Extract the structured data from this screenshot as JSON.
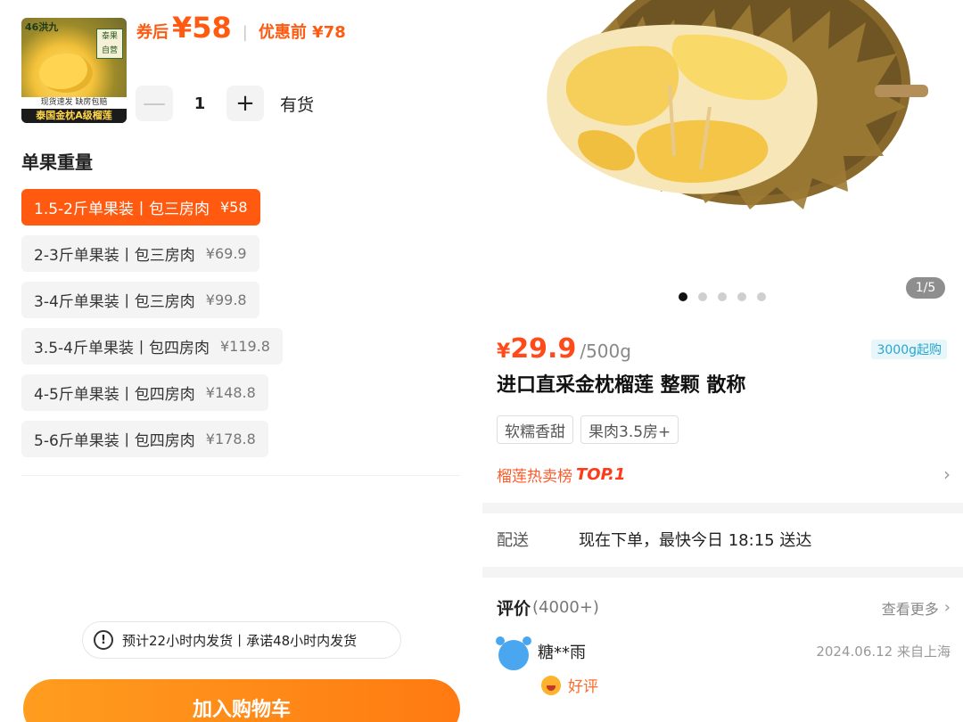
{
  "left": {
    "thumbnail": {
      "brand": "46洪九",
      "sticker": "泰果\n自营",
      "strip1": "现货速发  缺房包赔",
      "strip2": "泰国金枕A级榴莲"
    },
    "price_after_label": "券后",
    "price_after_value": "¥58",
    "separator": "|",
    "price_before": "优惠前 ¥78",
    "quantity": "1",
    "minus": "—",
    "plus": "+",
    "stock": "有货",
    "section_title": "单果重量",
    "options": [
      {
        "label": "1.5-2斤单果装丨包三房肉",
        "price": "¥58",
        "selected": true
      },
      {
        "label": "2-3斤单果装丨包三房肉",
        "price": "¥69.9",
        "selected": false
      },
      {
        "label": "3-4斤单果装丨包三房肉",
        "price": "¥99.8",
        "selected": false
      },
      {
        "label": "3.5-4斤单果装丨包四房肉",
        "price": "¥119.8",
        "selected": false
      },
      {
        "label": "4-5斤单果装丨包四房肉",
        "price": "¥148.8",
        "selected": false
      },
      {
        "label": "5-6斤单果装丨包四房肉",
        "price": "¥178.8",
        "selected": false
      }
    ],
    "notice_icon": "!",
    "notice": "预计22小时内发货丨承诺48小时内发货",
    "add_to_cart": "加入购物车"
  },
  "right": {
    "image_counter": "1/5",
    "dots": 5,
    "active_dot": 0,
    "price_currency": "¥",
    "price_value": "29.9",
    "price_unit": "/500g",
    "min_order": "3000g起购",
    "title": "进口直采金枕榴莲 整颗 散称",
    "tags": [
      "软糯香甜",
      "果肉3.5房+"
    ],
    "rank_text": "榴莲热卖榜",
    "rank_top": "TOP.1",
    "delivery_label": "配送",
    "delivery_value": "现在下单，最快今日 18:15 送达",
    "reviews_title": "评价",
    "reviews_count": "(4000+)",
    "reviews_more": "查看更多",
    "review": {
      "name": "糖**雨",
      "meta": "2024.06.12 来自上海",
      "rating": "好评"
    }
  },
  "colors": {
    "accent": "#ff5a10",
    "price_red": "#ff4a1a",
    "button_start": "#ff9d1f",
    "button_end": "#ff7a12",
    "badge_blue": "#27a7cf"
  }
}
